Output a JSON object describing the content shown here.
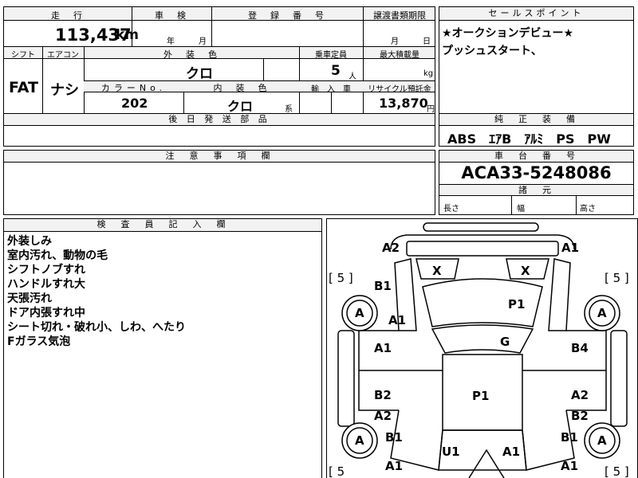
{
  "top_header": {
    "mileage_label": "走　行",
    "inspection_label": "車　検",
    "registration_label": "登　録　番　号",
    "transfer_doc_label": "譲渡書類期限",
    "sales_point_label": "セールスポイント"
  },
  "mileage": {
    "value": "113,437",
    "unit": "km"
  },
  "inspection": {
    "year_unit": "年",
    "month_unit": "月"
  },
  "transfer_doc": {
    "month_unit": "月",
    "day_unit": "日"
  },
  "sales_points": [
    "★オークションデビュー★",
    "プッシュスタート、"
  ],
  "spec_labels": {
    "shift": "シフト",
    "aircon": "エアコン",
    "exterior_color": "外　装　色",
    "capacity": "乗車定員",
    "max_load": "最大積載量",
    "color_no": "カラーNo.",
    "interior_color": "内　装　色",
    "import": "輸　入　車",
    "recycle": "リサイクル預託金"
  },
  "specs": {
    "shift": "FAT",
    "aircon": "ナシ",
    "exterior_color": "クロ",
    "capacity": "5",
    "capacity_unit": "人",
    "max_load_unit": "kg",
    "color_no": "202",
    "interior_color": "クロ",
    "interior_suffix": "系",
    "recycle_fee": "13,870",
    "recycle_unit": "円"
  },
  "later_parts_label": "後 日 発 送 部 品",
  "standard_equipment_label": "純　正　装　備",
  "standard_equipment": "ABS　ｴｱB　ｱﾙﾐ　PS　PW",
  "notes_label": "注　意　事　項　欄",
  "chassis_label": "車　台　番　号",
  "chassis_number": "ACA33-5248086",
  "dimensions_label": "諸　元",
  "dimensions": {
    "length": "長さ",
    "width": "幅",
    "height": "高さ"
  },
  "inspector_label": "検　査　員　記　入　欄",
  "inspector_notes": [
    "外装しみ",
    "室内汚れ、動物の毛",
    "シフトノブすれ",
    "ハンドルすれ大",
    "天張汚れ",
    "ドア内張すれ中",
    "シート切れ・破れ小、しわ、へたり",
    "Fガラス気泡"
  ],
  "diagram": {
    "tire_left_front": "[ 5 ]",
    "tire_right_front": "[ 5 ]",
    "tire_left_rear": "[ 5",
    "tire_right_rear": "[ 5 ]",
    "marks": {
      "front_left_corner": "A2",
      "front_right_corner": "A1",
      "light_left": "X",
      "light_right": "X",
      "fender_left": "B1",
      "fender_left_a": "A1",
      "wheel_fl": "A",
      "wheel_fr": "A",
      "hood": "P1",
      "windshield": "G",
      "door_fl": "A1",
      "door_fr": "B4",
      "door_rl_1": "B2",
      "door_rl_2": "A2",
      "door_rr_1": "A2",
      "door_rr_2": "B2",
      "roof": "P1",
      "wheel_rl": "A",
      "wheel_rr": "A",
      "qp_left": "B1",
      "qp_right": "B1",
      "rear_left": "A1",
      "rear_right": "A1",
      "trunk": "U1",
      "trunk_a": "A1"
    }
  }
}
